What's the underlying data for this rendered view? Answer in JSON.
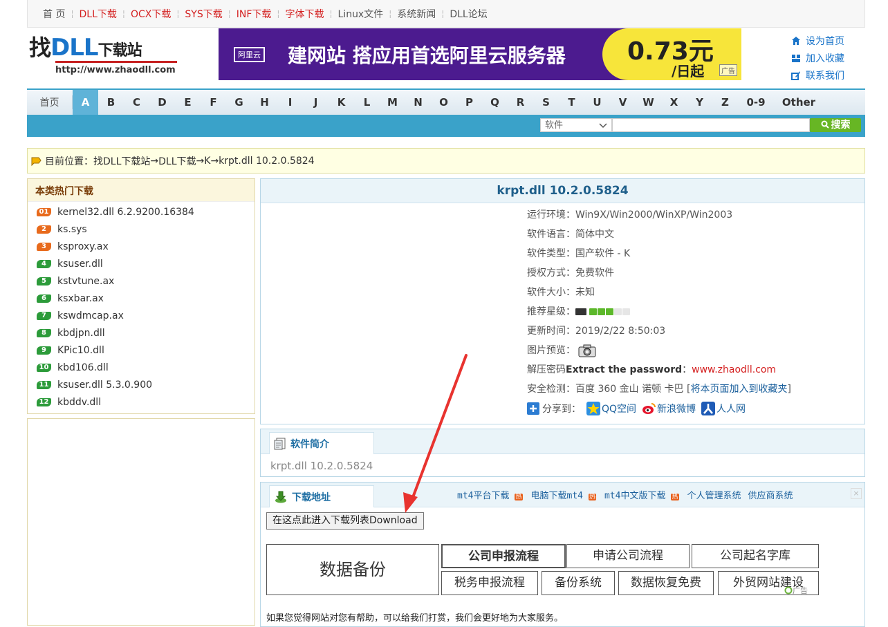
{
  "topnav": [
    {
      "label": "首 页",
      "color": "#555555"
    },
    {
      "label": "DLL下载",
      "color": "#d42020"
    },
    {
      "label": "OCX下载",
      "color": "#d42020"
    },
    {
      "label": "SYS下载",
      "color": "#d42020"
    },
    {
      "label": "INF下载",
      "color": "#d42020"
    },
    {
      "label": "字体下载",
      "color": "#d42020"
    },
    {
      "label": "Linux文件",
      "color": "#555555"
    },
    {
      "label": "系统新闻",
      "color": "#555555"
    },
    {
      "label": "DLL论坛",
      "color": "#555555"
    }
  ],
  "logo": {
    "zhao": "找",
    "dll": "DLL",
    "xiazai": "下载站",
    "url": "http://www.zhaodll.com"
  },
  "banner": {
    "brand": "阿里云",
    "slogan": "建网站 搭应用首选阿里云服务器",
    "price": "0.73元",
    "unit": "/日起",
    "ad": "广告"
  },
  "quick": [
    {
      "label": "设为首页",
      "icon": "home-icon"
    },
    {
      "label": "加入收藏",
      "icon": "favorites-icon"
    },
    {
      "label": "联系我们",
      "icon": "edit-icon"
    }
  ],
  "letters": {
    "home": "首页",
    "active": "A",
    "items": [
      "A",
      "B",
      "C",
      "D",
      "E",
      "F",
      "G",
      "H",
      "I",
      "J",
      "K",
      "L",
      "M",
      "N",
      "O",
      "P",
      "Q",
      "R",
      "S",
      "T",
      "U",
      "V",
      "W",
      "X",
      "Y",
      "Z",
      "0-9",
      "Other"
    ]
  },
  "search": {
    "select_value": "软件",
    "button": "搜索"
  },
  "breadcrumb": {
    "prefix": "目前位置：",
    "p1": "找DLL下载站",
    "arrow": " → ",
    "p2": "DLL下载",
    "p3": "K",
    "p4": "krpt.dll 10.2.0.5824"
  },
  "sidebar": {
    "title": "本类热门下载",
    "items": [
      {
        "n": "01",
        "name": "kernel32.dll 6.2.9200.16384",
        "color": "#e86a1c"
      },
      {
        "n": "2",
        "name": "ks.sys",
        "color": "#e86a1c"
      },
      {
        "n": "3",
        "name": "ksproxy.ax",
        "color": "#e86a1c"
      },
      {
        "n": "4",
        "name": "ksuser.dll",
        "color": "#2c9b3a"
      },
      {
        "n": "5",
        "name": "kstvtune.ax",
        "color": "#2c9b3a"
      },
      {
        "n": "6",
        "name": "ksxbar.ax",
        "color": "#2c9b3a"
      },
      {
        "n": "7",
        "name": "kswdmcap.ax",
        "color": "#2c9b3a"
      },
      {
        "n": "8",
        "name": "kbdjpn.dll",
        "color": "#2c9b3a"
      },
      {
        "n": "9",
        "name": "KPic10.dll",
        "color": "#2c9b3a"
      },
      {
        "n": "10",
        "name": "kbd106.dll",
        "color": "#2c9b3a"
      },
      {
        "n": "11",
        "name": "ksuser.dll 5.3.0.900",
        "color": "#2c9b3a"
      },
      {
        "n": "12",
        "name": "kbddv.dll",
        "color": "#2c9b3a"
      }
    ]
  },
  "info": {
    "title": "krpt.dll 10.2.0.5824",
    "env_k": "运行环境：",
    "env_v": "Win9X/Win2000/WinXP/Win2003",
    "lang_k": "软件语言：",
    "lang_v": "简体中文",
    "type_k": "软件类型：",
    "type_v": "国产软件 - K",
    "lic_k": "授权方式：",
    "lic_v": "免费软件",
    "size_k": "软件大小：",
    "size_v": "未知",
    "rating_k": "推荐星级：",
    "rating_value": 3,
    "rating_max": 5,
    "update_k": "更新时间：",
    "update_v": "2019/2/22 8:50:03",
    "preview_k": "图片预览：",
    "pwd_k": "解压密码",
    "pwd_en": "Extract the password",
    "pwd_colon": "：",
    "pwd_v": "www.zhaodll.com",
    "sec_k": "安全检测：",
    "sec_v": "百度 360 金山 诺顿 卡巴",
    "sec_link": "将本页面加入到收藏夹",
    "share_label": "分享到：",
    "share": [
      "QQ空间",
      "新浪微博",
      "人人网"
    ]
  },
  "intro": {
    "tab": "软件简介",
    "text": "krpt.dll 10.2.0.5824"
  },
  "download": {
    "tab": "下载地址",
    "ads": [
      "mt4平台下载",
      "电脑下载mt4",
      "mt4中文版下载",
      "个人管理系统",
      "供应商系统"
    ],
    "hot": "热",
    "close": "×",
    "button": "在这点此进入下载列表Download",
    "box": "数据备份",
    "chips_row1": [
      "公司申报流程",
      "申请公司流程",
      "公司起名字库"
    ],
    "chips_row2": [
      "税务申报流程",
      "备份系统",
      "数据恢复免费",
      "外贸网站建设"
    ],
    "ad_tag": "广告",
    "footer": "如果您觉得网站对您有帮助，可以给我们打赏，我们会更好地为大家服务。"
  }
}
